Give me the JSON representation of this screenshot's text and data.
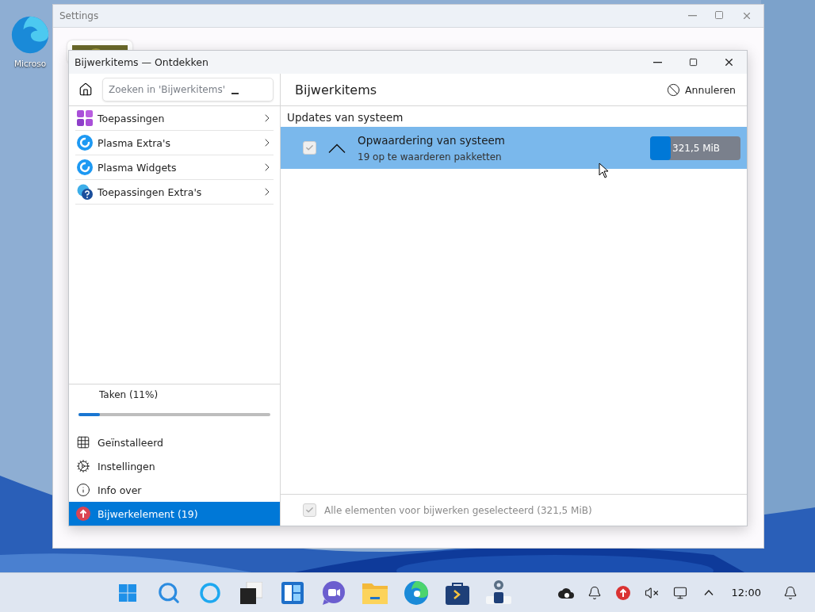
{
  "desktop": {
    "icons": [
      {
        "label": "Microso"
      }
    ]
  },
  "settings_window": {
    "title": "Settings"
  },
  "window": {
    "title": "Bijwerkitems — Ontdekken"
  },
  "search": {
    "placeholder": "Zoeken in 'Bijwerkitems'"
  },
  "categories": [
    {
      "label": "Toepassingen",
      "kind": "apps"
    },
    {
      "label": "Plasma Extra's",
      "kind": "plasma"
    },
    {
      "label": "Plasma Widgets",
      "kind": "plasma"
    },
    {
      "label": "Toepassingen Extra's",
      "kind": "help"
    }
  ],
  "progress": {
    "label": "Taken (11%)",
    "level": 0.11
  },
  "nav": [
    {
      "label": "Geïnstalleerd",
      "kind": "installed",
      "selected": false
    },
    {
      "label": "Instellingen",
      "kind": "settings",
      "selected": false
    },
    {
      "label": "Info over",
      "kind": "about",
      "selected": false
    },
    {
      "label": "Bijwerkelement (19)",
      "kind": "update",
      "selected": true
    }
  ],
  "main": {
    "title": "Bijwerkitems",
    "cancel": "Annuleren",
    "section": "Updates van systeem",
    "items": [
      {
        "title": "Opwaardering van systeem",
        "subtitle": "19 op te waarderen pakketten",
        "checked": true,
        "disabled": true,
        "expanded": true,
        "selected": true,
        "size": "321,5 MiB",
        "level": 0.23
      }
    ],
    "footer": {
      "label": "Alle elementen voor bijwerken geselecteerd (321,5 MiB)",
      "checked": true,
      "disabled": true
    }
  },
  "taskbar": {
    "apps": [
      {
        "kind": "start"
      },
      {
        "kind": "search"
      },
      {
        "kind": "cortana"
      },
      {
        "kind": "taskview"
      },
      {
        "kind": "widgets"
      },
      {
        "kind": "chat"
      },
      {
        "kind": "explorer"
      },
      {
        "kind": "edge"
      },
      {
        "kind": "store"
      },
      {
        "kind": "discover"
      }
    ],
    "tray": [
      {
        "kind": "cloud"
      },
      {
        "kind": "bell"
      },
      {
        "kind": "update"
      },
      {
        "kind": "mute"
      },
      {
        "kind": "network"
      },
      {
        "kind": "chevron"
      }
    ],
    "clock": "12:00"
  }
}
